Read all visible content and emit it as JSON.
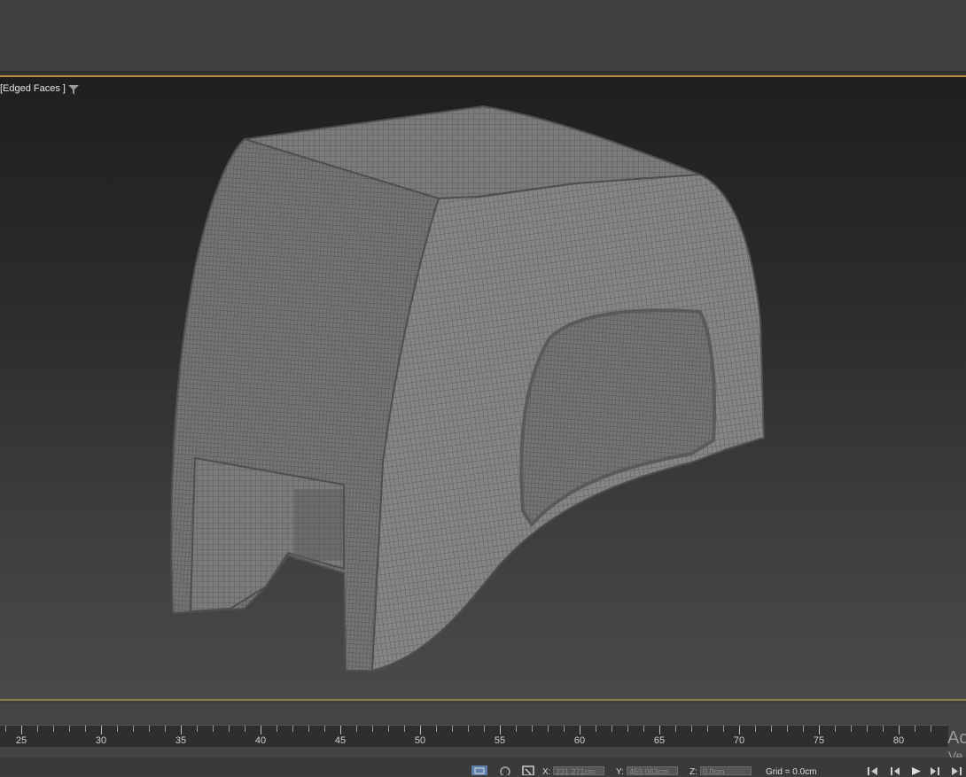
{
  "viewport": {
    "label": "[Edged Faces ]",
    "filter_icon": "filter-icon",
    "object": "wireframe-mesh-seat-shell"
  },
  "timeline": {
    "ticks": [
      "25",
      "30",
      "35",
      "40",
      "45",
      "50",
      "55",
      "60",
      "65",
      "70",
      "75",
      "80"
    ]
  },
  "watermark": {
    "line1": "Ac",
    "line2": "Ve"
  },
  "status_bar": {
    "x_label": "X:",
    "x_value": "231.271cm",
    "y_label": "Y:",
    "y_value": "459.063cm",
    "z_label": "Z:",
    "z_value": "0.0cm",
    "grid": "Grid = 0.0cm",
    "icons": [
      "selection-lock-icon",
      "isolate-icon",
      "absolute-mode-icon"
    ],
    "playback": [
      "go-to-start-icon",
      "previous-frame-icon",
      "play-icon",
      "next-frame-icon",
      "go-to-end-icon"
    ]
  },
  "colors": {
    "viewport_border": "#b58d3d",
    "mesh_fill": "#7a7a7a",
    "mesh_line": "#5b5b5b"
  }
}
